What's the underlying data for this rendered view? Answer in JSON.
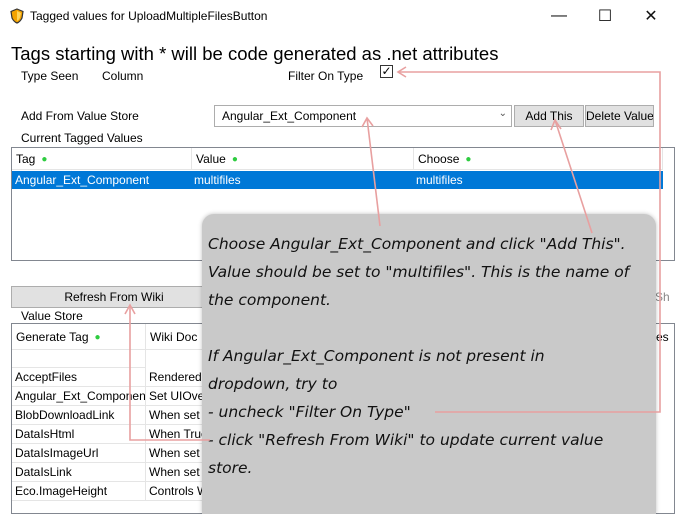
{
  "window": {
    "title": "Tagged values for UploadMultipleFilesButton",
    "minimize": "—",
    "maximize": "☐",
    "close": "✕"
  },
  "headline": "Tags starting with * will be code generated as .net attributes",
  "options": {
    "type_seen": "Type Seen",
    "column": "Column",
    "filter_label": "Filter On Type",
    "filter_checked": true,
    "check_mark": "✓"
  },
  "add_from": {
    "label": "Add From Value Store",
    "selected": "Angular_Ext_Component",
    "add_button": "Add This",
    "delete_button": "Delete Value"
  },
  "current": {
    "label": "Current Tagged Values",
    "columns": [
      "Tag",
      "Value",
      "Choose"
    ],
    "rows": [
      {
        "tag": "Angular_Ext_Component",
        "value": "multifiles",
        "choose": "multifiles"
      }
    ]
  },
  "refresh_button": "Refresh From Wiki",
  "sh_fragment": "Sh",
  "store": {
    "label": "Value Store",
    "columns": [
      "Generate Tag",
      "Wiki Doc"
    ],
    "es_fragment": "es",
    "rows": [
      {
        "tag": "AcceptFiles",
        "doc": "Rendered"
      },
      {
        "tag": "Angular_Ext_Component",
        "doc": "Set UIOver"
      },
      {
        "tag": "BlobDownloadLink",
        "doc": "When set"
      },
      {
        "tag": "DataIsHtml",
        "doc": "When True"
      },
      {
        "tag": "DataIsImageUrl",
        "doc": "When set"
      },
      {
        "tag": "DataIsLink",
        "doc": "When set"
      },
      {
        "tag": "Eco.ImageHeight",
        "doc": "Controls W"
      }
    ]
  },
  "callout": {
    "line1": "Choose Angular_Ext_Component and click \"Add This\".",
    "line2": "Value should be set to \"multifiles\". This is the name of",
    "line3": "the component.",
    "line4": "If Angular_Ext_Component is not present in",
    "line5": "dropdown, try to",
    "line6": "- uncheck \"Filter On Type\"",
    "line7": "- click \"Refresh From Wiki\" to update current value",
    "line8": "store."
  },
  "colors": {
    "selection": "#0078d7",
    "callout_bg": "#c9c9c9",
    "arrow": "#e8a0a0",
    "star": "#2ecc40"
  }
}
